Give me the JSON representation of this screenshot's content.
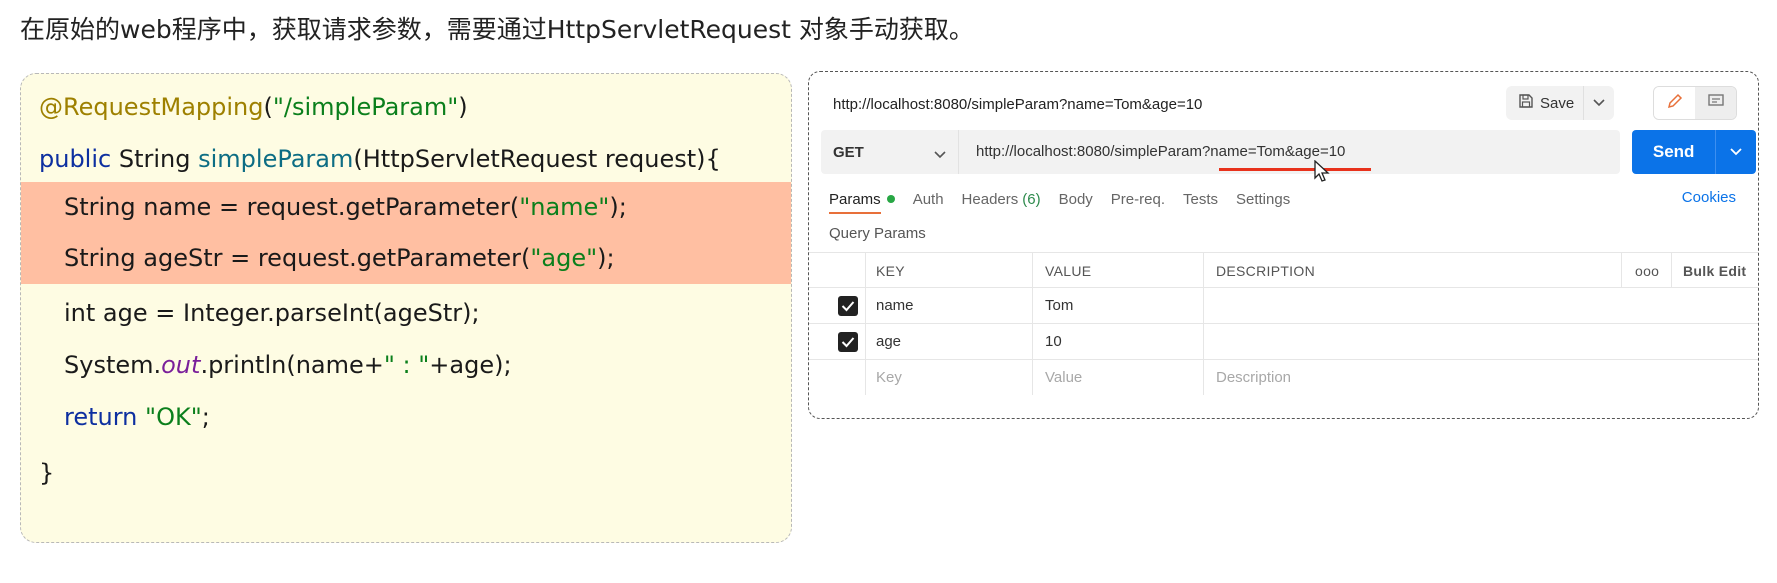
{
  "heading": "在原始的web程序中，获取请求参数，需要通过HttpServletRequest 对象手动获取。",
  "code": {
    "line1": {
      "annotation": "@RequestMapping",
      "open": "(",
      "path": "\"/simpleParam\"",
      "close": ")"
    },
    "line2": {
      "kw_public": "public",
      "type": " String ",
      "method": "simpleParam",
      "params": "(HttpServletRequest request){"
    },
    "line3": {
      "pre": "String name = request.getParameter(",
      "str": "\"name\"",
      "post": ");"
    },
    "line4": {
      "pre": "String ageStr = request.getParameter(",
      "str": "\"age\"",
      "post": ");"
    },
    "line5": {
      "text": "int age = Integer.parseInt(ageStr);"
    },
    "line6": {
      "pre": "System.",
      "out": "out",
      "mid": ".println(name+",
      "str": "\" : \"",
      "post": "+age);"
    },
    "line7": {
      "kw": "return",
      "space": " ",
      "str": "\"OK\"",
      "post": ";"
    },
    "line8": {
      "text": "}"
    }
  },
  "postman": {
    "title": "http://localhost:8080/simpleParam?name=Tom&age=10",
    "save_label": "Save",
    "method": "GET",
    "url": "http://localhost:8080/simpleParam?name=Tom&age=10",
    "send_label": "Send",
    "tabs": {
      "params": "Params",
      "auth": "Auth",
      "headers": "Headers",
      "headers_count": "(6)",
      "body": "Body",
      "prereq": "Pre-req.",
      "tests": "Tests",
      "settings": "Settings"
    },
    "cookies": "Cookies",
    "query_params_label": "Query Params",
    "table": {
      "headers": {
        "key": "KEY",
        "value": "VALUE",
        "description": "DESCRIPTION",
        "more": "ooo",
        "bulk_edit": "Bulk Edit"
      },
      "rows": [
        {
          "key": "name",
          "value": "Tom",
          "description": ""
        },
        {
          "key": "age",
          "value": "10",
          "description": ""
        }
      ],
      "placeholder": {
        "key": "Key",
        "value": "Value",
        "description": "Description"
      }
    },
    "colors": {
      "accent": "#0b73e8",
      "highlight": "#ffbfa2",
      "code_bg": "#fefce3",
      "underline": "#e8321c"
    }
  }
}
